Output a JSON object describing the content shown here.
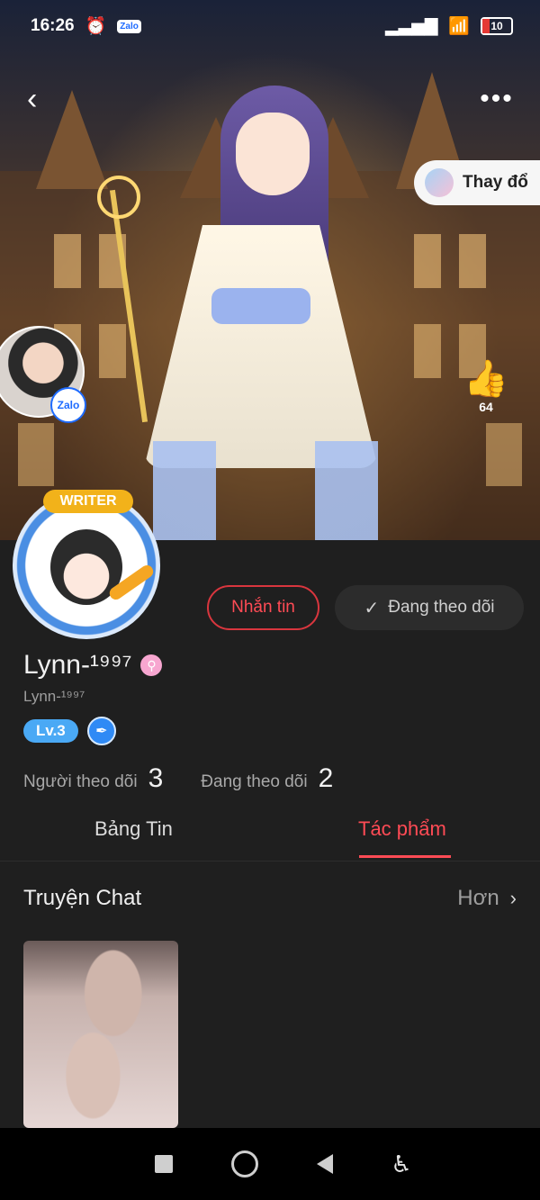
{
  "status_bar": {
    "time": "16:26",
    "zalo_label": "Zalo",
    "battery": "10"
  },
  "cover": {
    "change_button_label": "Thay đổ",
    "zalo_badge": "Zalo",
    "like_count": "64"
  },
  "profile": {
    "writer_badge": "WRITER",
    "message_button": "Nhắn tin",
    "following_button": "Đang theo dõi",
    "display_name": "Lynn-¹⁹⁹⁷",
    "username": "Lynn-¹⁹⁹⁷",
    "level": "Lv.3",
    "followers_label": "Người theo dõi",
    "followers_count": "3",
    "following_label": "Đang theo dõi",
    "following_count": "2"
  },
  "tabs": {
    "news": "Bảng Tin",
    "works": "Tác phẩm"
  },
  "section": {
    "title": "Truyện Chat",
    "more": "Hơn"
  },
  "icons": {
    "back": "back-arrow-icon",
    "more": "more-dots-icon",
    "like": "thumbs-up-icon",
    "check": "check-icon",
    "chevron": "chevron-right-icon"
  },
  "colors": {
    "accent": "#ff4b55",
    "background": "#1f1f1f",
    "level": "#4aa9f5"
  }
}
